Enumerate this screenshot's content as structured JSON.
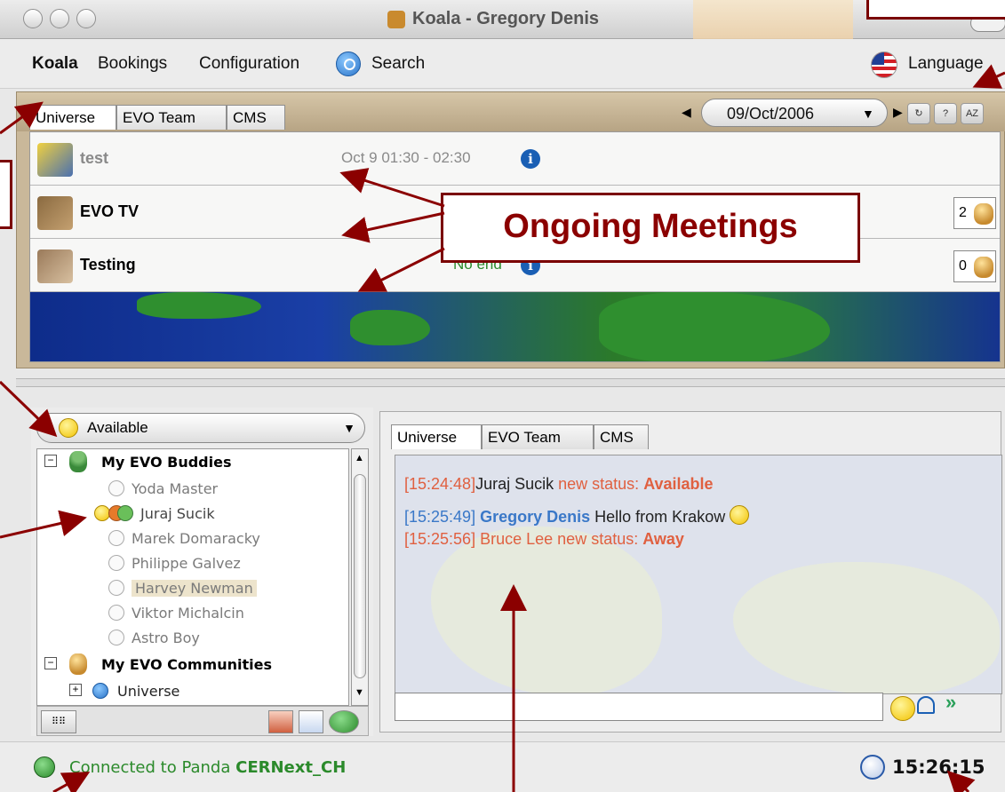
{
  "window": {
    "title": "Koala - Gregory Denis"
  },
  "menu": {
    "items": [
      "Koala",
      "Bookings",
      "Configuration",
      "Search"
    ],
    "language": "Language"
  },
  "upper_tabs": [
    "Universe",
    "EVO Team",
    "CMS"
  ],
  "date": {
    "value": "09/Oct/2006"
  },
  "toolbar": {
    "sort_label": "AZ"
  },
  "meetings": [
    {
      "name": "test",
      "time": "Oct 9 01:30 - 02:30",
      "count": ""
    },
    {
      "name": "EVO TV",
      "time": "",
      "count": "2"
    },
    {
      "name": "Testing",
      "time": "No end",
      "count": "0"
    }
  ],
  "callout": {
    "label": "Ongoing Meetings"
  },
  "status_select": {
    "value": "Available"
  },
  "buddies": {
    "group1": "My EVO Buddies",
    "items": [
      "Yoda Master",
      "Juraj Sucik",
      "Marek Domaracky",
      "Philippe Galvez",
      "Harvey Newman",
      "Viktor Michalcin",
      "Astro Boy"
    ],
    "group2": "My EVO Communities",
    "community": "Universe"
  },
  "chat_tabs": [
    "Universe",
    "EVO Team",
    "CMS"
  ],
  "chat": {
    "line1": {
      "time": "[15:24:48]",
      "who": "Juraj Sucik",
      "event": "new status:",
      "status": "Available"
    },
    "line2": {
      "time": "[15:25:49]",
      "who": "Gregory Denis",
      "message": "Hello from Krakow"
    },
    "line3": {
      "time": "[15:25:56]",
      "who": "Bruce Lee",
      "event": "new status:",
      "status": "Away"
    }
  },
  "statusbar": {
    "connected_prefix": "Connected to Panda",
    "server": "CERNext_CH",
    "clock": "15:26:15"
  },
  "colors": {
    "accent_red": "#8b0000",
    "link_blue": "#3a78c8",
    "event_red": "#e06040",
    "connected_green": "#2b8a2b"
  },
  "icons": [
    "search-icon",
    "flag-icon",
    "info-icon",
    "smile-icon",
    "clock-icon",
    "bell-icon",
    "send-icon"
  ]
}
